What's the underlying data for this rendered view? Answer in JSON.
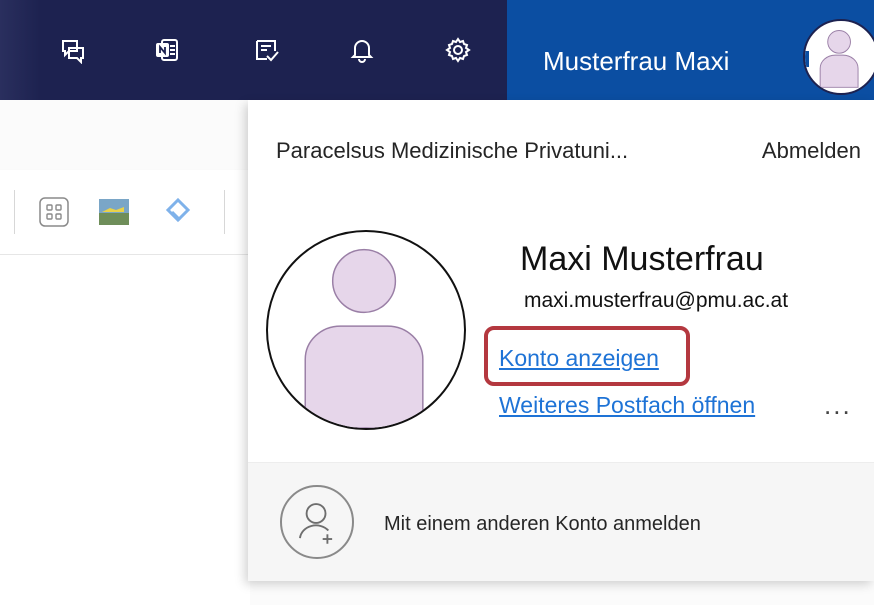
{
  "header": {
    "icons": [
      "chat-feedback-icon",
      "onenote-icon",
      "tasks-icon",
      "bell-icon",
      "gear-icon"
    ],
    "account_name": "Musterfrau Maxi",
    "colors": {
      "bar": "#1d2250",
      "account": "#0b4ea2"
    }
  },
  "toolbar": {
    "icons": [
      "apps-grid-icon",
      "landscape-app-icon",
      "viva-app-icon"
    ]
  },
  "panel": {
    "organization": "Paracelsus Medizinische Privatuni...",
    "sign_out": "Abmelden",
    "user_name": "Maxi Musterfrau",
    "email": "maxi.musterfrau@pmu.ac.at",
    "view_account": "Konto anzeigen",
    "open_mailbox": "Weiteres Postfach öffnen",
    "more": "...",
    "add_account": "Mit einem anderen Konto anmelden",
    "colors": {
      "link": "#1e73d6",
      "highlight": "#b4383f",
      "avatar_fill": "#e6d6ea",
      "avatar_stroke": "#9a7fa6"
    }
  }
}
